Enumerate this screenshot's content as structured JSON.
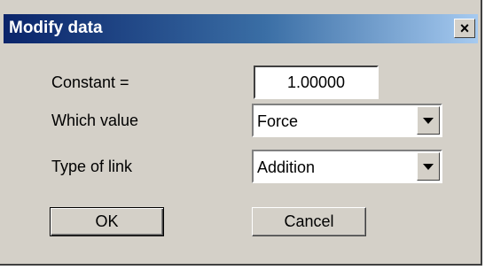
{
  "window": {
    "title": "Modify data",
    "close_glyph": "×"
  },
  "fields": {
    "constant_label": "Constant =",
    "constant_value": "1.00000",
    "which_value_label": "Which value",
    "which_value_selected": "Force",
    "type_of_link_label": "Type of link",
    "type_of_link_selected": "Addition"
  },
  "buttons": {
    "ok_label": "OK",
    "cancel_label": "Cancel"
  },
  "icons": {
    "close": "close-icon",
    "dropdown": "dropdown-arrow-icon"
  },
  "colors": {
    "titlebar_start": "#0a246a",
    "titlebar_end": "#a6caf0",
    "face": "#d4d0c8"
  }
}
